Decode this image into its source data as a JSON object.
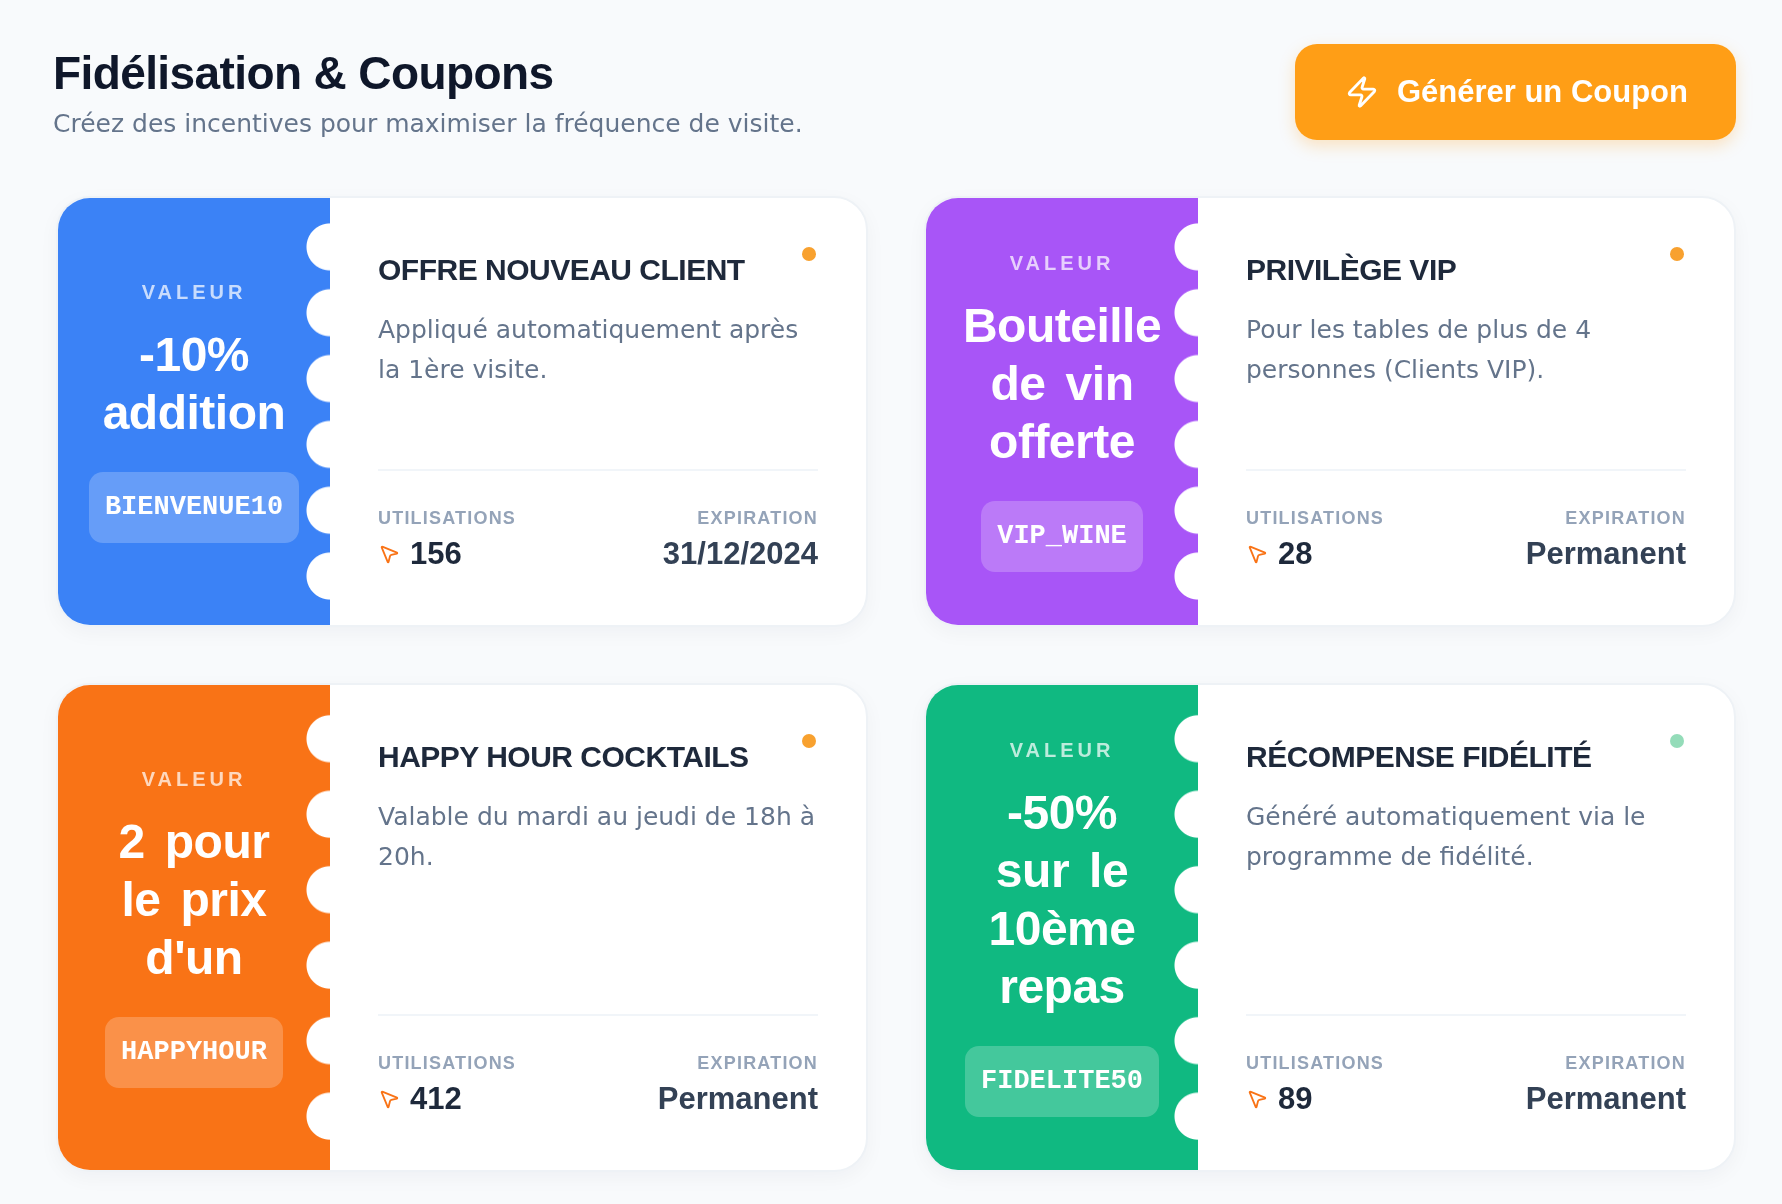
{
  "header": {
    "title": "Fidélisation & Coupons",
    "subtitle": "Créez des incentives pour maximiser la fréquence de visite.",
    "button": {
      "label": "Générer un Coupon"
    }
  },
  "coupons": [
    {
      "color": "#3b82f6",
      "value_label": "VALEUR",
      "value": "-10% addition",
      "code": "BIENVENUE10",
      "title": "OFFRE NOUVEAU CLIENT",
      "status_dot": {
        "color": "#f8a12f"
      },
      "description": "Appliqué automatiquement après la 1ère visite.",
      "uses_label": "UTILISATIONS",
      "uses": "156",
      "expiration_label": "EXPIRATION",
      "expiration": "31/12/2024"
    },
    {
      "color": "#a855f7",
      "value_label": "VALEUR",
      "value": "Bouteille de vin offerte",
      "code": "VIP_WINE",
      "title": "PRIVILÈGE VIP",
      "status_dot": {
        "color": "#f8a12f"
      },
      "description": "Pour les tables de plus de 4 personnes (Clients VIP).",
      "uses_label": "UTILISATIONS",
      "uses": "28",
      "expiration_label": "EXPIRATION",
      "expiration": "Permanent"
    },
    {
      "color": "#f97316",
      "value_label": "VALEUR",
      "value": "2 pour le prix d'un",
      "code": "HAPPYHOUR",
      "title": "HAPPY HOUR COCKTAILS",
      "status_dot": {
        "color": "#f8a12f"
      },
      "description": "Valable du mardi au jeudi de 18h à 20h.",
      "uses_label": "UTILISATIONS",
      "uses": "412",
      "expiration_label": "EXPIRATION",
      "expiration": "Permanent"
    },
    {
      "color": "#10b981",
      "value_label": "VALEUR",
      "value": "-50% sur le 10ème repas",
      "code": "FIDELITE50",
      "title": "RÉCOMPENSE FIDÉLITÉ",
      "status_dot": {
        "color": "#94dcb9"
      },
      "description": "Généré automatiquement via le programme de fidélité.",
      "uses_label": "UTILISATIONS",
      "uses": "89",
      "expiration_label": "EXPIRATION",
      "expiration": "Permanent"
    }
  ]
}
